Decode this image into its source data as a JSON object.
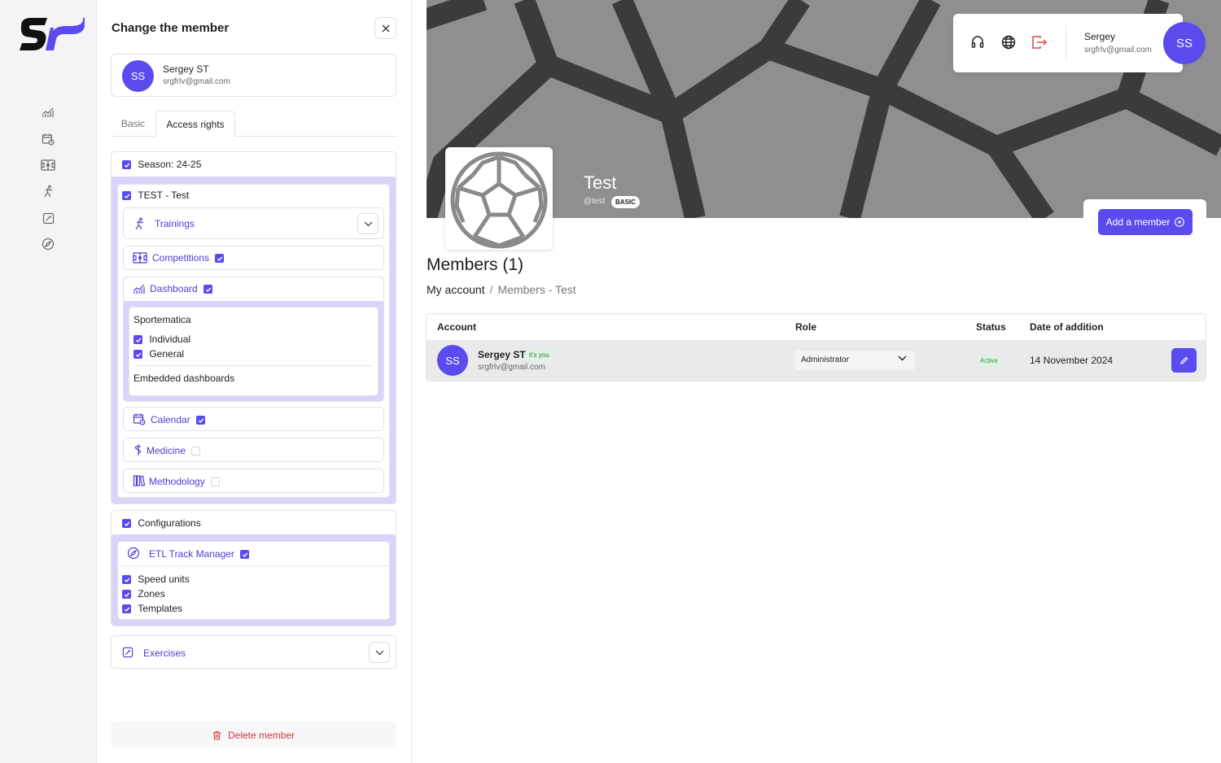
{
  "colors": {
    "accent": "#5b4bee",
    "danger": "#d0363b",
    "success": "#2a9d4a"
  },
  "nav": {
    "items": [
      "analytics-icon",
      "calendar-icon",
      "competitions-icon",
      "trainings-icon",
      "exercises-icon",
      "etl-icon"
    ]
  },
  "panel": {
    "title": "Change the member",
    "member": {
      "initials": "SS",
      "name": "Sergey ST",
      "email": "srgfrlv@gmail.com"
    },
    "tabs": [
      "Basic",
      "Access rights"
    ],
    "season_label": "Season: 24-25",
    "team_label": "TEST - Test",
    "modules": {
      "trainings": "Trainings",
      "competitions": "Competitions",
      "dashboard": "Dashboard",
      "calendar": "Calendar",
      "medicine": "Medicine",
      "methodology": "Methodology"
    },
    "dashboard_group": {
      "title": "Sportematica",
      "items": [
        "Individual",
        "General"
      ],
      "embedded": "Embedded dashboards"
    },
    "configurations_label": "Configurations",
    "etl": {
      "label": "ETL Track Manager",
      "items": [
        "Speed units",
        "Zones",
        "Templates"
      ]
    },
    "exercises_label": "Exercises",
    "delete_label": "Delete member"
  },
  "topbar": {
    "user_name": "Sergey",
    "user_email": "srgfrlv@gmail.com",
    "initials": "SS"
  },
  "team": {
    "name": "Test",
    "handle": "@test",
    "plan": "BASIC"
  },
  "add_member_label": "Add a member",
  "main": {
    "title": "Members (1)",
    "breadcrumb": [
      "My account",
      "Members - Test"
    ]
  },
  "table": {
    "headers": [
      "Account",
      "Role",
      "Status",
      "Date of addition"
    ],
    "rows": [
      {
        "initials": "SS",
        "name": "Sergey ST",
        "you": "it's you",
        "email": "srgfrlv@gmail.com",
        "role": "Administrator",
        "status": "Active",
        "date": "14 November 2024"
      }
    ]
  }
}
